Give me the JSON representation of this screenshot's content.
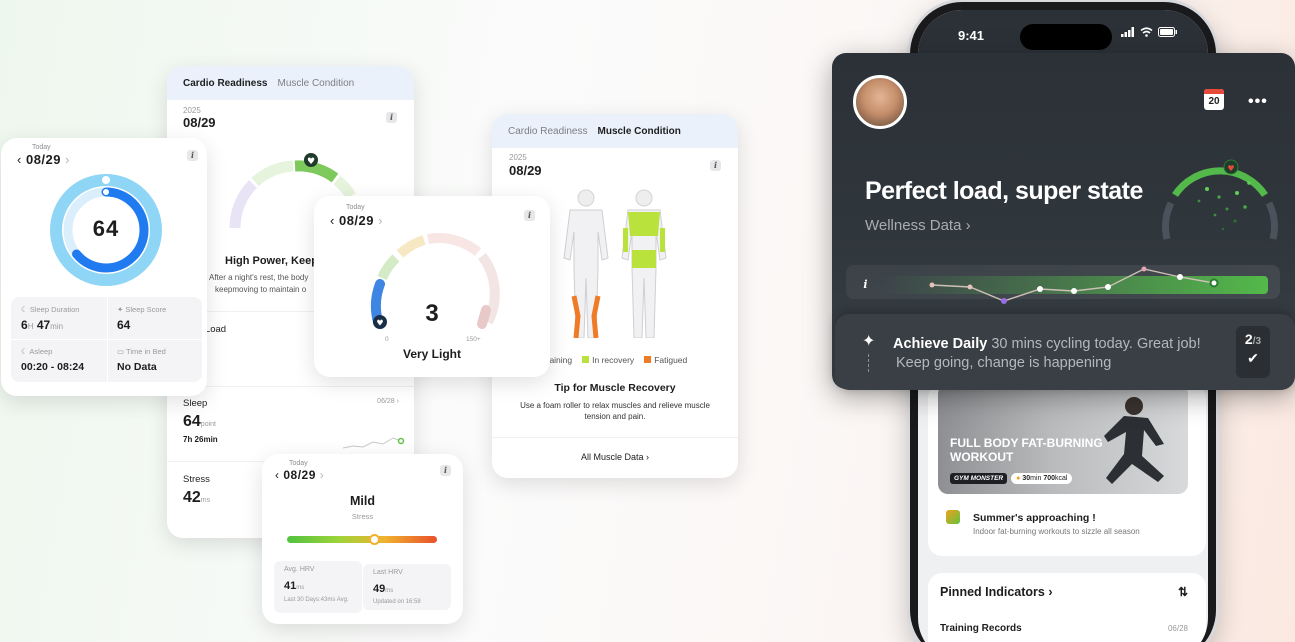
{
  "sleep_card": {
    "today": "Today",
    "date": "08/29",
    "score": "64",
    "metrics": [
      {
        "label": "Sleep Duration",
        "h": "6",
        "h_unit": "H",
        "m": "47",
        "m_unit": "min"
      },
      {
        "label": "Sleep Score",
        "value": "64"
      },
      {
        "label": "Asleep",
        "value": "00:20 - 08:24"
      },
      {
        "label": "Time in Bed",
        "value": "No Data"
      }
    ]
  },
  "cardio_card": {
    "tab_active": "Cardio Readiness",
    "tab_other": "Muscle Condition",
    "year": "2025",
    "date": "08/29",
    "headline": "High Power, Keep",
    "desc_line1": "After a night's rest, the body",
    "desc_line2": "keepmoving to maintain o",
    "load_label": "p Load",
    "sleep": {
      "label": "Sleep",
      "date": "06/28",
      "value": "64",
      "unit": "point",
      "dur": "7h 26min"
    },
    "stress": {
      "label": "Stress",
      "value": "42",
      "unit": "ms"
    }
  },
  "load_card": {
    "today": "Today",
    "date": "08/29",
    "value": "3",
    "min": "0",
    "max": "150+",
    "status": "Very Light"
  },
  "stress_card": {
    "today": "Today",
    "date": "08/29",
    "status": "Mild",
    "sub": "Stress",
    "avg_label": "Avg. HRV",
    "avg_value": "41",
    "avg_unit": "ms",
    "avg_note": "Last 30 Days:43ms Avg.",
    "last_label": "Last HRV",
    "last_value": "49",
    "last_unit": "ms",
    "last_note": "Updated on 16:58"
  },
  "muscle_card": {
    "tab_other": "Cardio Readiness",
    "tab_active": "Muscle Condition",
    "year": "2025",
    "date": "08/29",
    "legend": [
      "l training",
      "In recovery",
      "Fatigued"
    ],
    "tip_title": "Tip for Muscle Recovery",
    "tip_line1": "Use a foam roller to relax muscles and relieve muscle",
    "tip_line2": "tension and pain.",
    "link": "All Muscle Data"
  },
  "phone": {
    "time": "9:41",
    "calendar_day": "20",
    "headline": "Perfect load, super state",
    "wellness_link": "Wellness Data",
    "achieve_title": "Achieve Daily",
    "achieve_text": "30 mins cycling today. Great job!",
    "achieve_sub": "Keep going, change is happening",
    "progress_num": "2",
    "progress_den": "/3",
    "workout_title_1": "FULL BODY FAT-BURNING",
    "workout_title_2": "WORKOUT",
    "workout_brand": "GYM MONSTER",
    "workout_min": "30",
    "workout_min_unit": "min",
    "workout_kcal": "700",
    "workout_kcal_unit": "kcal",
    "promo_title": "Summer's approaching !",
    "promo_sub": "Indoor fat-burning workouts to sizzle all season",
    "pinned": "Pinned Indicators",
    "training_records": "Training Records",
    "training_date": "06/28"
  },
  "colors": {
    "ring_blue": "#1f7bef",
    "ring_light": "#7fd1f5",
    "green": "#5ab54a",
    "dark_panel": "#2b3137"
  }
}
